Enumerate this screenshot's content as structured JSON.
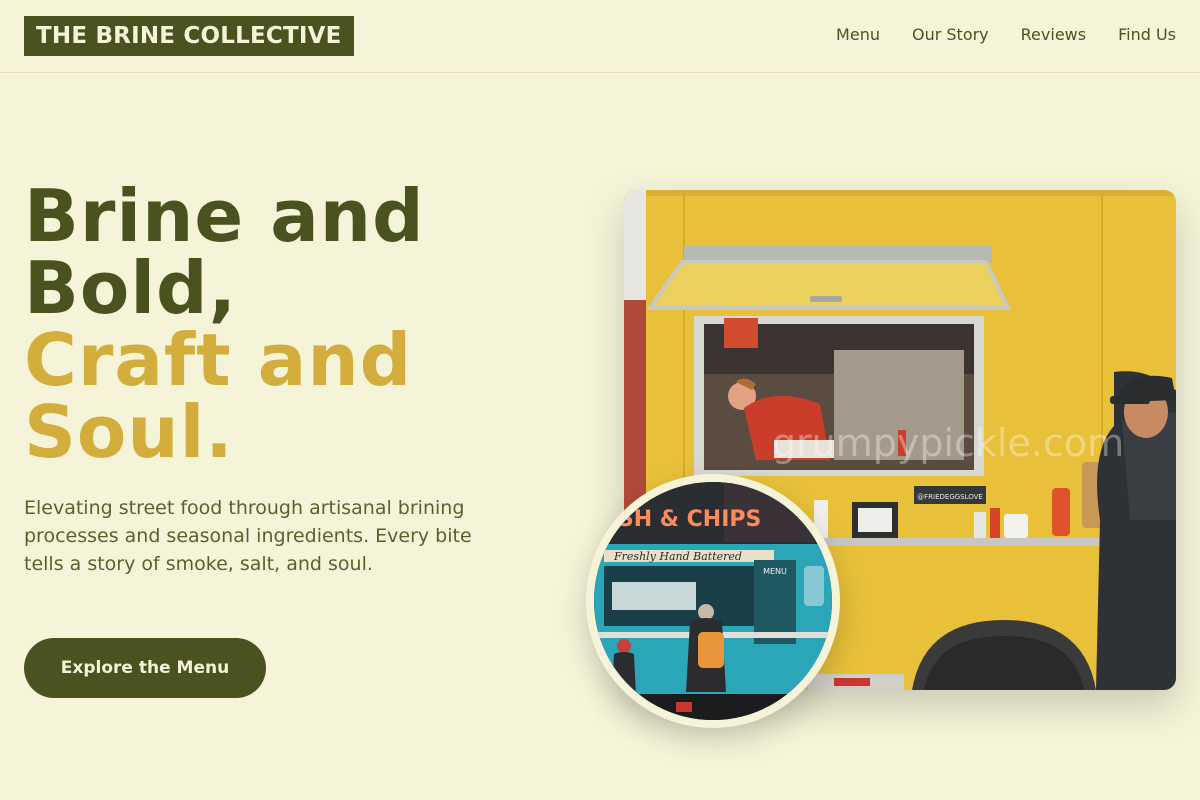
{
  "brand": {
    "name": "THE BRINE COLLECTIVE"
  },
  "nav": {
    "items": [
      {
        "label": "Menu"
      },
      {
        "label": "Our Story"
      },
      {
        "label": "Reviews"
      },
      {
        "label": "Find Us"
      }
    ]
  },
  "hero": {
    "title_line1": "Brine and Bold,",
    "title_line2": "Craft and Soul.",
    "description": "Elevating street food through artisanal brining processes and seasonal ingredients. Every bite tells a story of smoke, salt, and soul.",
    "cta_label": "Explore the Menu"
  },
  "images": {
    "main": {
      "tag_text": "@FRIEDEGGSLOVE",
      "watermark": "grumpypickle.com"
    },
    "inset": {
      "sign_text": "FISH & CHIPS",
      "script_text": "Freshly Hand Battered",
      "menu_text": "MENU"
    }
  },
  "colors": {
    "background": "#f5f4d8",
    "primary": "#4a5320",
    "accent": "#d4ae3c",
    "truck_yellow": "#e8c03a",
    "truck_teal": "#2aa6b8"
  }
}
